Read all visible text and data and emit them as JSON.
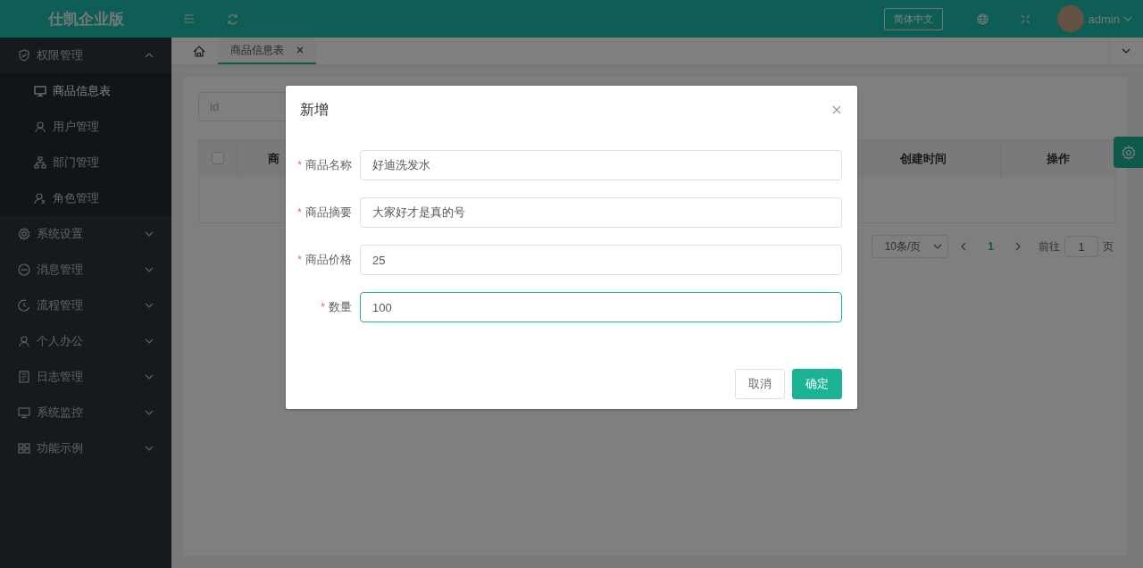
{
  "header": {
    "logo": "仕凯企业版",
    "language_button": "简体中文",
    "user": "admin"
  },
  "sidebar": {
    "items": [
      {
        "label": "权限管理",
        "expanded": true,
        "children": [
          {
            "label": "商品信息表",
            "selected": true
          },
          {
            "label": "用户管理",
            "selected": false
          },
          {
            "label": "部门管理",
            "selected": false
          },
          {
            "label": "角色管理",
            "selected": false
          }
        ]
      },
      {
        "label": "系统设置",
        "expanded": false
      },
      {
        "label": "消息管理",
        "expanded": false
      },
      {
        "label": "流程管理",
        "expanded": false
      },
      {
        "label": "个人办公",
        "expanded": false
      },
      {
        "label": "日志管理",
        "expanded": false
      },
      {
        "label": "系统监控",
        "expanded": false
      },
      {
        "label": "功能示例",
        "expanded": false
      }
    ]
  },
  "tabs": [
    {
      "label": "商品信息表",
      "selected": true
    }
  ],
  "search": {
    "placeholder": "id"
  },
  "table": {
    "select_all_checked": false,
    "columns": [
      "商",
      "创建时间",
      "操作"
    ]
  },
  "pagination": {
    "page_size": "10条/页",
    "current_page": "1",
    "goto_label": "前往",
    "goto_value": "1",
    "page_suffix": "页"
  },
  "dialog": {
    "title": "新增",
    "fields": [
      {
        "required_mark": "*",
        "label": "商品名称",
        "value": "好迪洗发水",
        "focused": false
      },
      {
        "required_mark": "*",
        "label": "商品摘要",
        "value": "大家好才是真的号",
        "focused": false
      },
      {
        "required_mark": "*",
        "label": "商品价格",
        "value": "25",
        "focused": false
      },
      {
        "required_mark": "*",
        "label": "数量",
        "value": "100",
        "focused": true
      }
    ],
    "buttons": [
      {
        "label": "取消",
        "kind": "default"
      },
      {
        "label": "确定",
        "kind": "primary"
      }
    ]
  }
}
